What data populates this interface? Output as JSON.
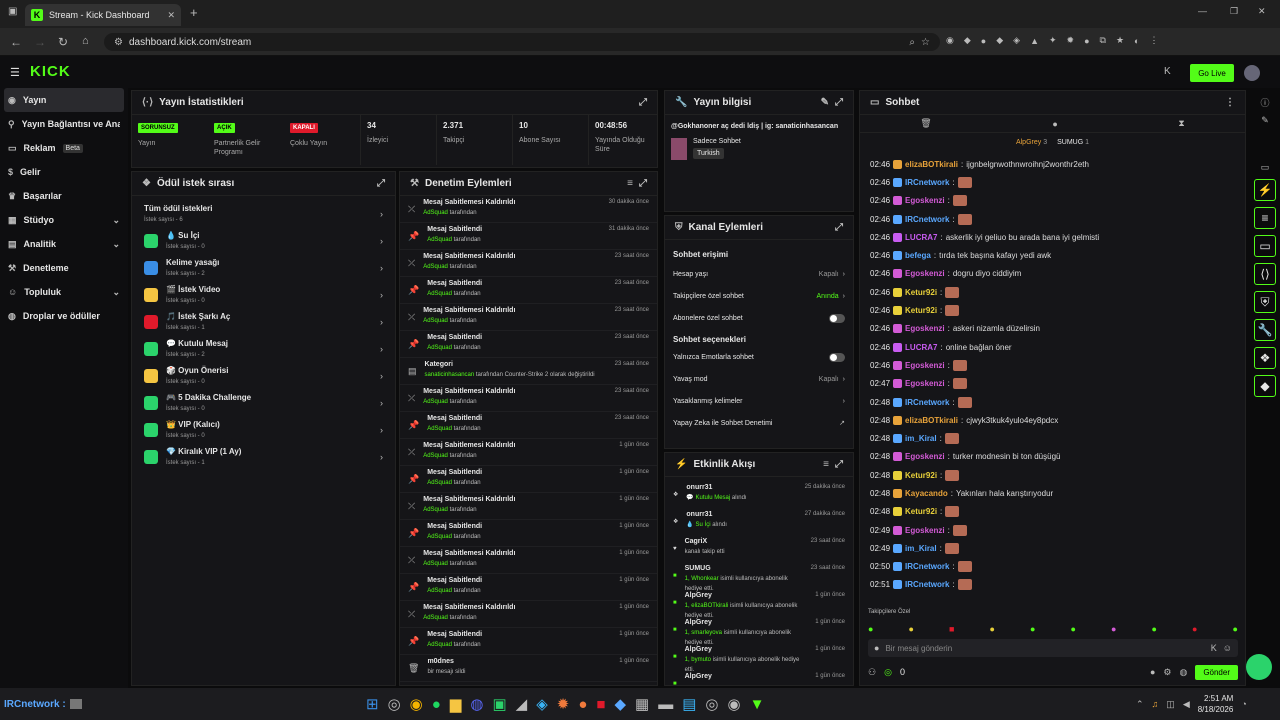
{
  "browser": {
    "tab_title": "Stream - Kick Dashboard",
    "url": "dashboard.kick.com/stream"
  },
  "kick": {
    "logo": "KICK",
    "go_live": "Go Live"
  },
  "sidebar": {
    "items": [
      {
        "label": "Yayın"
      },
      {
        "label": "Yayın Bağlantısı ve Anahtarı"
      },
      {
        "label": "Reklam",
        "badge": "Beta"
      },
      {
        "label": "Gelir"
      },
      {
        "label": "Başarılar"
      },
      {
        "label": "Stüdyo"
      },
      {
        "label": "Analitik"
      },
      {
        "label": "Denetleme"
      },
      {
        "label": "Topluluk"
      },
      {
        "label": "Droplar ve ödüller"
      }
    ]
  },
  "stats": {
    "title": "Yayın İstatistikleri",
    "cells": [
      {
        "badge": "SORUNSUZ",
        "label": "Yayın"
      },
      {
        "badge": "AÇIK",
        "label": "Partnerlik Gelir Programı"
      },
      {
        "badge": "KAPALI",
        "label": "Çoklu Yayın"
      },
      {
        "value": "34",
        "label": "İzleyici"
      },
      {
        "value": "2.371",
        "label": "Takipçi"
      },
      {
        "value": "10",
        "label": "Abone Sayısı"
      },
      {
        "value": "00:48:56",
        "label": "Yayında Olduğu Süre"
      }
    ]
  },
  "rewards": {
    "title": "Ödül istek sırası",
    "all": "Tüm ödül istekleri",
    "all_count": "İstek sayısı - 6",
    "items": [
      {
        "name": "💧 Su İçi",
        "count": "İstek sayısı - 0"
      },
      {
        "name": "Kelime yasağı",
        "count": "İstek sayısı - 2"
      },
      {
        "name": "🎬 İstek Video",
        "count": "İstek sayısı - 0"
      },
      {
        "name": "🎵 İstek Şarkı Aç",
        "count": "İstek sayısı - 1"
      },
      {
        "name": "💬 Kutulu Mesaj",
        "count": "İstek sayısı - 2"
      },
      {
        "name": "🎲 Oyun Önerisi",
        "count": "İstek sayısı - 0"
      },
      {
        "name": "🎮 5 Dakika Challenge",
        "count": "İstek sayısı - 0"
      },
      {
        "name": "👑 VIP (Kalıcı)",
        "count": "İstek sayısı - 0"
      },
      {
        "name": "💎 Kiralık VIP (1 Ay)",
        "count": "İstek sayısı - 1"
      }
    ]
  },
  "mod": {
    "title": "Denetim Eylemleri",
    "items": [
      {
        "title": "Mesaj Sabitlemesi Kaldırıldı",
        "by": "AdSquad",
        "suffix": "tarafından",
        "date": "30 dakika önce"
      },
      {
        "title": "Mesaj Sabitlendi",
        "by": "AdSquad",
        "suffix": "tarafından",
        "date": "31 dakika önce"
      },
      {
        "title": "Mesaj Sabitlemesi Kaldırıldı",
        "by": "AdSquad",
        "suffix": "tarafından",
        "date": "23 saat önce"
      },
      {
        "title": "Mesaj Sabitlendi",
        "by": "AdSquad",
        "suffix": "tarafından",
        "date": "23 saat önce"
      },
      {
        "title": "Mesaj Sabitlemesi Kaldırıldı",
        "by": "AdSquad",
        "suffix": "tarafından",
        "date": "23 saat önce"
      },
      {
        "title": "Mesaj Sabitlendi",
        "by": "AdSquad",
        "suffix": "tarafından",
        "date": "23 saat önce"
      },
      {
        "title": "Kategori",
        "by": "sanaticinhasancan",
        "suffix": "tarafından Counter-Strike 2 olarak değiştirildi",
        "date": "23 saat önce"
      },
      {
        "title": "Mesaj Sabitlemesi Kaldırıldı",
        "by": "AdSquad",
        "suffix": "tarafından",
        "date": "23 saat önce"
      },
      {
        "title": "Mesaj Sabitlendi",
        "by": "AdSquad",
        "suffix": "tarafından",
        "date": "23 saat önce"
      },
      {
        "title": "Mesaj Sabitlemesi Kaldırıldı",
        "by": "AdSquad",
        "suffix": "tarafından",
        "date": "1 gün önce"
      },
      {
        "title": "Mesaj Sabitlendi",
        "by": "AdSquad",
        "suffix": "tarafından",
        "date": "1 gün önce"
      },
      {
        "title": "Mesaj Sabitlemesi Kaldırıldı",
        "by": "AdSquad",
        "suffix": "tarafından",
        "date": "1 gün önce"
      },
      {
        "title": "Mesaj Sabitlendi",
        "by": "AdSquad",
        "suffix": "tarafından",
        "date": "1 gün önce"
      },
      {
        "title": "Mesaj Sabitlemesi Kaldırıldı",
        "by": "AdSquad",
        "suffix": "tarafından",
        "date": "1 gün önce"
      },
      {
        "title": "Mesaj Sabitlendi",
        "by": "AdSquad",
        "suffix": "tarafından",
        "date": "1 gün önce"
      },
      {
        "title": "Mesaj Sabitlemesi Kaldırıldı",
        "by": "AdSquad",
        "suffix": "tarafından",
        "date": "1 gün önce"
      },
      {
        "title": "Mesaj Sabitlendi",
        "by": "AdSquad",
        "suffix": "tarafından",
        "date": "1 gün önce"
      },
      {
        "title": "m0dnes",
        "by": "",
        "suffix": "bir mesajı sildi",
        "date": "1 gün önce"
      }
    ]
  },
  "info": {
    "title": "Yayın bilgisi",
    "stream_title": "@Gokhanoner aç dedi ldiş | ig: sanaticinhasancan",
    "category": "Sadece Sohbet",
    "tag": "Turkish"
  },
  "channel": {
    "title": "Kanal Eylemleri",
    "access": "Sohbet erişimi",
    "rows": [
      {
        "label": "Hesap yaşı",
        "value": "Kapalı",
        "ctrl": "chev"
      },
      {
        "label": "Takipçilere özel sohbet",
        "value": "Anında",
        "ctrl": "chev",
        "green": true
      },
      {
        "label": "Abonelere özel sohbet",
        "value": "",
        "ctrl": "toggle"
      }
    ],
    "options": "Sohbet seçenekleri",
    "rows2": [
      {
        "label": "Yalnızca Emotlarla sohbet",
        "value": "",
        "ctrl": "toggle"
      },
      {
        "label": "Yavaş mod",
        "value": "Kapalı",
        "ctrl": "chev"
      },
      {
        "label": "Yasaklanmış kelimeler",
        "value": "",
        "ctrl": "chev"
      },
      {
        "label": "Yapay Zeka ile Sohbet Denetimi",
        "value": "",
        "ctrl": "ext"
      }
    ]
  },
  "activity": {
    "title": "Etkinlik Akışı",
    "items": [
      {
        "user": "onurr31",
        "desc": "💬 Kutulu Mesaj",
        "suffix": "alındı",
        "date": "25 dakika önce"
      },
      {
        "user": "onurr31",
        "desc": "💧 Su İçi",
        "suffix": "alındı",
        "date": "27 dakika önce"
      },
      {
        "user": "CagriX",
        "desc": "",
        "suffix": "kanalı takip etti",
        "date": "23 saat önce"
      },
      {
        "user": "SUMUG",
        "desc": "1, Whonkear",
        "suffix": "isimli kullanıcıya abonelik hediye etti.",
        "date": "23 saat önce"
      },
      {
        "user": "AlpGrey",
        "desc": "1, elizaBOTkirali",
        "suffix": "isimli kullanıcıya abonelik hediye etti.",
        "date": "1 gün önce"
      },
      {
        "user": "AlpGrey",
        "desc": "1, smarleyova",
        "suffix": "isimli kullanıcıya abonelik hediye etti.",
        "date": "1 gün önce"
      },
      {
        "user": "AlpGrey",
        "desc": "1, bymuto",
        "suffix": "isimli kullanıcıya abonelik hediye etti.",
        "date": "1 gün önce"
      },
      {
        "user": "AlpGrey",
        "desc": "",
        "suffix": "",
        "date": "1 gün önce"
      }
    ]
  },
  "chat": {
    "title": "Sohbet",
    "gifter1": "AlpGrey",
    "gifter1_n": "3",
    "gifter2": "SUMUG",
    "gifter2_n": "1",
    "messages": [
      {
        "time": "02:46",
        "user": "elizaBOTkirali",
        "color": "#e8a33a",
        "text": "ijgnbelgnwothnwroihnj2wonthr2eth"
      },
      {
        "time": "02:46",
        "user": "IRCnetwork",
        "color": "#5aa8ff",
        "text": ""
      },
      {
        "time": "02:46",
        "user": "Egoskenzi",
        "color": "#d35bd6",
        "text": ""
      },
      {
        "time": "02:46",
        "user": "IRCnetwork",
        "color": "#5aa8ff",
        "text": ""
      },
      {
        "time": "02:46",
        "user": "LUCRA7",
        "color": "#c85cf0",
        "text": "askerlik iyi geliuo bu arada bana iyi gelmisti"
      },
      {
        "time": "02:46",
        "user": "befega",
        "color": "#5aa8ff",
        "text": "tırda tek başına kafayı yedi awk"
      },
      {
        "time": "02:46",
        "user": "Egoskenzi",
        "color": "#d35bd6",
        "text": "dogru diyo ciddiyim"
      },
      {
        "time": "02:46",
        "user": "Ketur92i",
        "color": "#e8d03a",
        "text": ""
      },
      {
        "time": "02:46",
        "user": "Ketur92i",
        "color": "#e8d03a",
        "text": ""
      },
      {
        "time": "02:46",
        "user": "Egoskenzi",
        "color": "#d35bd6",
        "text": "askeri nizamla düzelirsin"
      },
      {
        "time": "02:46",
        "user": "LUCRA7",
        "color": "#c85cf0",
        "text": "online bağlan öner"
      },
      {
        "time": "02:46",
        "user": "Egoskenzi",
        "color": "#d35bd6",
        "text": ""
      },
      {
        "time": "02:47",
        "user": "Egoskenzi",
        "color": "#d35bd6",
        "text": ""
      },
      {
        "time": "02:48",
        "user": "IRCnetwork",
        "color": "#5aa8ff",
        "text": ""
      },
      {
        "time": "02:48",
        "user": "elizaBOTkirali",
        "color": "#e8a33a",
        "text": "cjwyk3tkuk4yulo4ey8pdcx"
      },
      {
        "time": "02:48",
        "user": "im_Kiral",
        "color": "#5aa8ff",
        "text": ""
      },
      {
        "time": "02:48",
        "user": "Egoskenzi",
        "color": "#d35bd6",
        "text": "turker modnesin bi ton düşügü"
      },
      {
        "time": "02:48",
        "user": "Ketur92i",
        "color": "#e8d03a",
        "text": ""
      },
      {
        "time": "02:48",
        "user": "Kayacando",
        "color": "#e8a33a",
        "text": "Yakınları hala karıştırıyodur"
      },
      {
        "time": "02:48",
        "user": "Ketur92i",
        "color": "#e8d03a",
        "text": ""
      },
      {
        "time": "02:49",
        "user": "Egoskenzi",
        "color": "#d35bd6",
        "text": ""
      },
      {
        "time": "02:49",
        "user": "im_Kiral",
        "color": "#5aa8ff",
        "text": ""
      },
      {
        "time": "02:50",
        "user": "IRCnetwork",
        "color": "#5aa8ff",
        "text": ""
      },
      {
        "time": "02:51",
        "user": "IRCnetwork",
        "color": "#5aa8ff",
        "text": ""
      }
    ],
    "followers_only": "Takipçilere Özel",
    "placeholder": "Bir mesaj gönderin",
    "send": "Gönder",
    "count": "0"
  },
  "taskbar": {
    "ticker": "IRCnetwork :",
    "time": "2:51 AM",
    "date": "8/18/2026"
  }
}
